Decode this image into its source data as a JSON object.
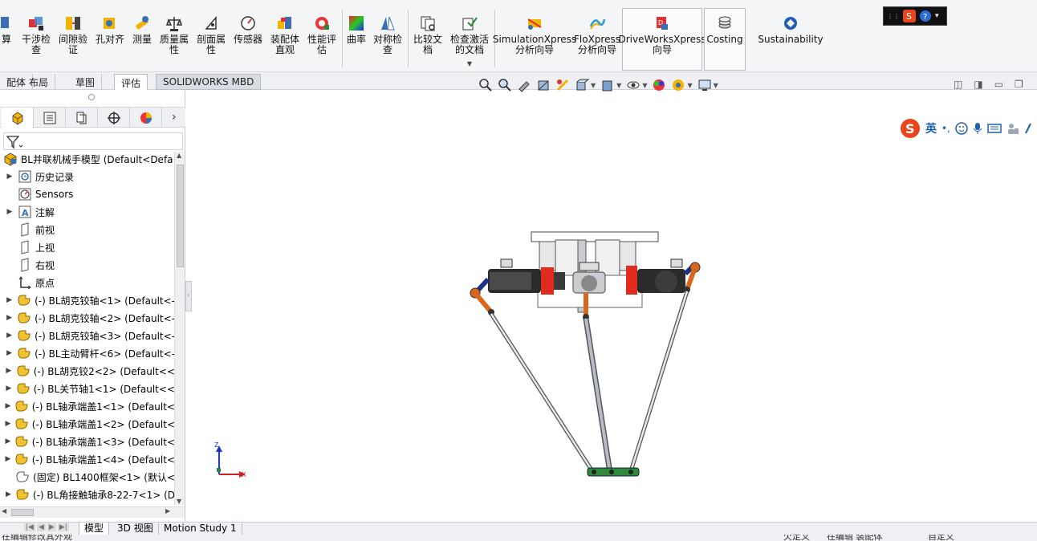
{
  "ribbon": {
    "partial_left": "算",
    "buttons": [
      {
        "id": "interference",
        "label": "干涉检\n查"
      },
      {
        "id": "clearance",
        "label": "间隙验\n证"
      },
      {
        "id": "hole-align",
        "label": "孔对齐"
      },
      {
        "id": "measure",
        "label": "测量"
      },
      {
        "id": "mass-props",
        "label": "质量属\n性"
      },
      {
        "id": "section-props",
        "label": "剖面属\n性"
      },
      {
        "id": "sensor",
        "label": "传感器"
      },
      {
        "id": "assy-visual",
        "label": "装配体\n直观"
      },
      {
        "id": "performance",
        "label": "性能评\n估"
      },
      {
        "id": "curvature",
        "label": "曲率"
      },
      {
        "id": "symmetry",
        "label": "对称检\n查"
      },
      {
        "id": "compare-docs",
        "label": "比较文\n档"
      },
      {
        "id": "check-active",
        "label": "检查激活\n的文档"
      },
      {
        "id": "simxpress",
        "label": "SimulationXpress\n分析向导"
      },
      {
        "id": "floxpress",
        "label": "FloXpress\n分析向导"
      },
      {
        "id": "driveworks",
        "label": "DriveWorksXpress\n向导"
      },
      {
        "id": "costing",
        "label": "Costing"
      },
      {
        "id": "sustainability",
        "label": "Sustainability"
      }
    ]
  },
  "command_tabs": [
    "配体",
    "布局",
    "草图",
    "评估",
    "SOLIDWORKS MBD"
  ],
  "active_command_tab": "评估",
  "feature_tree": {
    "root": "BL并联机械手模型  (Default<Defa",
    "items": [
      {
        "label": "历史记录",
        "icon": "history-icon",
        "expand": true
      },
      {
        "label": "Sensors",
        "icon": "sensor-icon",
        "expand": false
      },
      {
        "label": "注解",
        "icon": "annotation-icon",
        "expand": true
      },
      {
        "label": "前视",
        "icon": "plane-icon",
        "expand": false
      },
      {
        "label": "上视",
        "icon": "plane-icon",
        "expand": false
      },
      {
        "label": "右视",
        "icon": "plane-icon",
        "expand": false
      },
      {
        "label": "原点",
        "icon": "origin-icon",
        "expand": false
      },
      {
        "label": "(-) BL胡克铰轴<1> (Default<-",
        "icon": "part-icon",
        "expand": true
      },
      {
        "label": "(-) BL胡克铰轴<2> (Default<-",
        "icon": "part-icon",
        "expand": true
      },
      {
        "label": "(-) BL胡克铰轴<3> (Default<-",
        "icon": "part-icon",
        "expand": true
      },
      {
        "label": "(-) BL主动臂杆<6> (Default<-",
        "icon": "part-icon",
        "expand": true
      },
      {
        "label": "(-) BL胡克铰2<2> (Default<<",
        "icon": "part-icon",
        "expand": true
      },
      {
        "label": "(-) BL关节轴1<1> (Default<<",
        "icon": "part-icon",
        "expand": true
      },
      {
        "label": "(-) BL轴承端盖1<1> (Default<",
        "icon": "part-icon",
        "expand": true
      },
      {
        "label": "(-) BL轴承端盖1<2> (Default<",
        "icon": "part-icon",
        "expand": true
      },
      {
        "label": "(-) BL轴承端盖1<3> (Default<",
        "icon": "part-icon",
        "expand": true
      },
      {
        "label": "(-) BL轴承端盖1<4> (Default<",
        "icon": "part-icon",
        "expand": true
      },
      {
        "label": "(固定) BL1400框架<1> (默认<",
        "icon": "fixed-part-icon",
        "expand": false
      },
      {
        "label": "(-) BL角接触轴承8-22-7<1> (D",
        "icon": "part-icon",
        "expand": true
      }
    ]
  },
  "bottom_tabs": [
    "模型",
    "3D 视图",
    "Motion Study 1"
  ],
  "active_bottom_tab": "模型",
  "status": {
    "left": "在编辑修改其外观",
    "mid1": "欠定义",
    "mid2": "在编辑 装配体",
    "right": "自定义"
  },
  "triad": {
    "z": "Z",
    "x": "X"
  },
  "ime": {
    "lang": "英"
  },
  "colors": {
    "accent": "#1f5fb4",
    "motor_red": "#e12b1e",
    "joint_orange": "#d9661d",
    "green_joint": "#2f8a3a"
  }
}
